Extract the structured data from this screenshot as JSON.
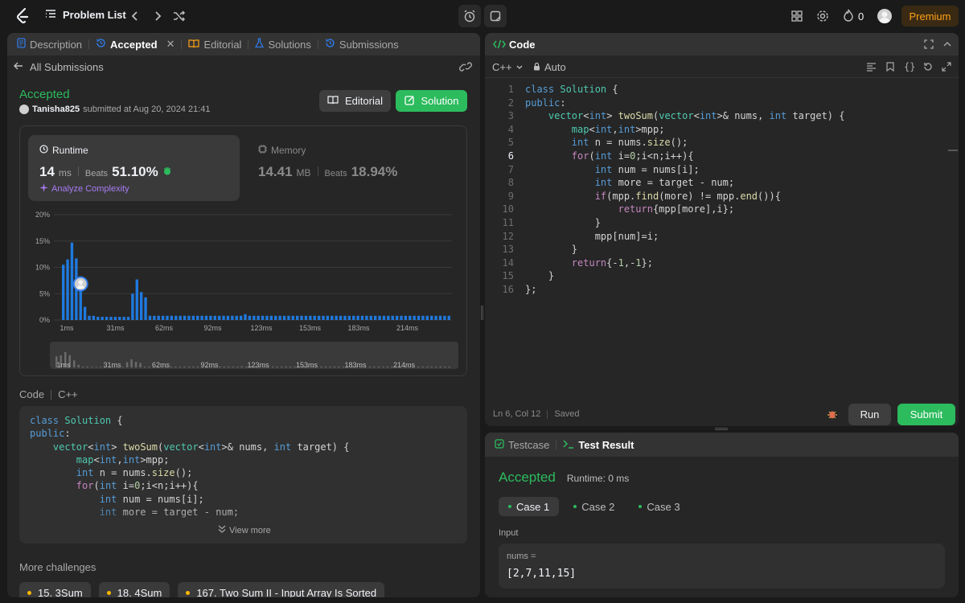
{
  "topbar": {
    "problem_list": "Problem List",
    "streak_count": "0",
    "premium": "Premium"
  },
  "left_tabs": [
    {
      "label": "Description"
    },
    {
      "label": "Accepted"
    },
    {
      "label": "Editorial"
    },
    {
      "label": "Solutions"
    },
    {
      "label": "Submissions"
    }
  ],
  "submission": {
    "back_label": "All Submissions",
    "status": "Accepted",
    "user": "Tanisha825",
    "submitted_text": "submitted at Aug 20, 2024 21:41",
    "editorial_btn": "Editorial",
    "solution_btn": "Solution"
  },
  "stats": {
    "runtime_label": "Runtime",
    "runtime_value": "14",
    "runtime_unit": "ms",
    "beats_label": "Beats",
    "runtime_beats": "51.10%",
    "analyze": "Analyze Complexity",
    "memory_label": "Memory",
    "memory_value": "14.41",
    "memory_unit": "MB",
    "memory_beats": "18.94%"
  },
  "chart_data": {
    "type": "bar",
    "y_ticks": [
      "20%",
      "15%",
      "10%",
      "5%",
      "0%"
    ],
    "ylim": [
      0,
      20
    ],
    "x_ticks": [
      "1ms",
      "31ms",
      "62ms",
      "92ms",
      "123ms",
      "153ms",
      "183ms",
      "214ms"
    ],
    "values": [
      10.5,
      11.5,
      14.7,
      11.7,
      6.7,
      2.5,
      0.8,
      0.8,
      0.6,
      0.6,
      0.6,
      0.6,
      0.6,
      0.6,
      0.6,
      0.6,
      5,
      7.7,
      5.3,
      4.3,
      0.8,
      0.8,
      0.8,
      0.8,
      0.8,
      0.8,
      0.8,
      0.8,
      0.8,
      0.8,
      0.8,
      0.8,
      0.8,
      0.8,
      0.8,
      0.8,
      0.8,
      0.8,
      0.8,
      0.8,
      0.8,
      0.8,
      1.1,
      0.8,
      0.8,
      0.8,
      0.8,
      0.8,
      0.8,
      0.8,
      0.8,
      0.8,
      0.8,
      0.8,
      0.8,
      0.8,
      0.8,
      0.8,
      0.8,
      0.8,
      0.8,
      0.8,
      0.8,
      0.8,
      0.8,
      0.8,
      0.8,
      0.8,
      0.8,
      0.8,
      0.8,
      0.8,
      0.8,
      0.8,
      0.8,
      0.8,
      0.8,
      0.8,
      0.8,
      0.8,
      0.8,
      0.8,
      0.8,
      0.8,
      0.8,
      0.8,
      0.8,
      0.8,
      0.8,
      0.8
    ],
    "highlight_index": 4,
    "bar_color": "#1f7ae0"
  },
  "code_preview": {
    "label": "Code",
    "lang": "C++",
    "view_more": "View more"
  },
  "more": {
    "title": "More challenges",
    "items": [
      "15. 3Sum",
      "18. 4Sum",
      "167. Two Sum II - Input Array Is Sorted"
    ]
  },
  "editor": {
    "title": "Code",
    "lang": "C++",
    "auto": "Auto",
    "status_pos": "Ln 6, Col 12",
    "status_saved": "Saved",
    "run": "Run",
    "submit": "Submit"
  },
  "code_lines": [
    "class Solution {",
    "public:",
    "    vector<int> twoSum(vector<int>& nums, int target) {",
    "        map<int,int>mpp;",
    "        int n = nums.size();",
    "        for(int i=0;i<n;i++){",
    "            int num = nums[i];",
    "            int more = target - num;",
    "            if(mpp.find(more) != mpp.end()){",
    "                return{mpp[more],i};",
    "            }",
    "            mpp[num]=i;",
    "        }",
    "        return{-1,-1};",
    "    }",
    "};"
  ],
  "result": {
    "testcase_tab": "Testcase",
    "result_tab": "Test Result",
    "status": "Accepted",
    "runtime": "Runtime: 0 ms",
    "cases": [
      "Case 1",
      "Case 2",
      "Case 3"
    ],
    "input_label": "Input",
    "var_name": "nums =",
    "var_value": "[2,7,11,15]"
  },
  "colors": {
    "accent_green": "#2cbb5d",
    "premium": "#ffa116"
  }
}
